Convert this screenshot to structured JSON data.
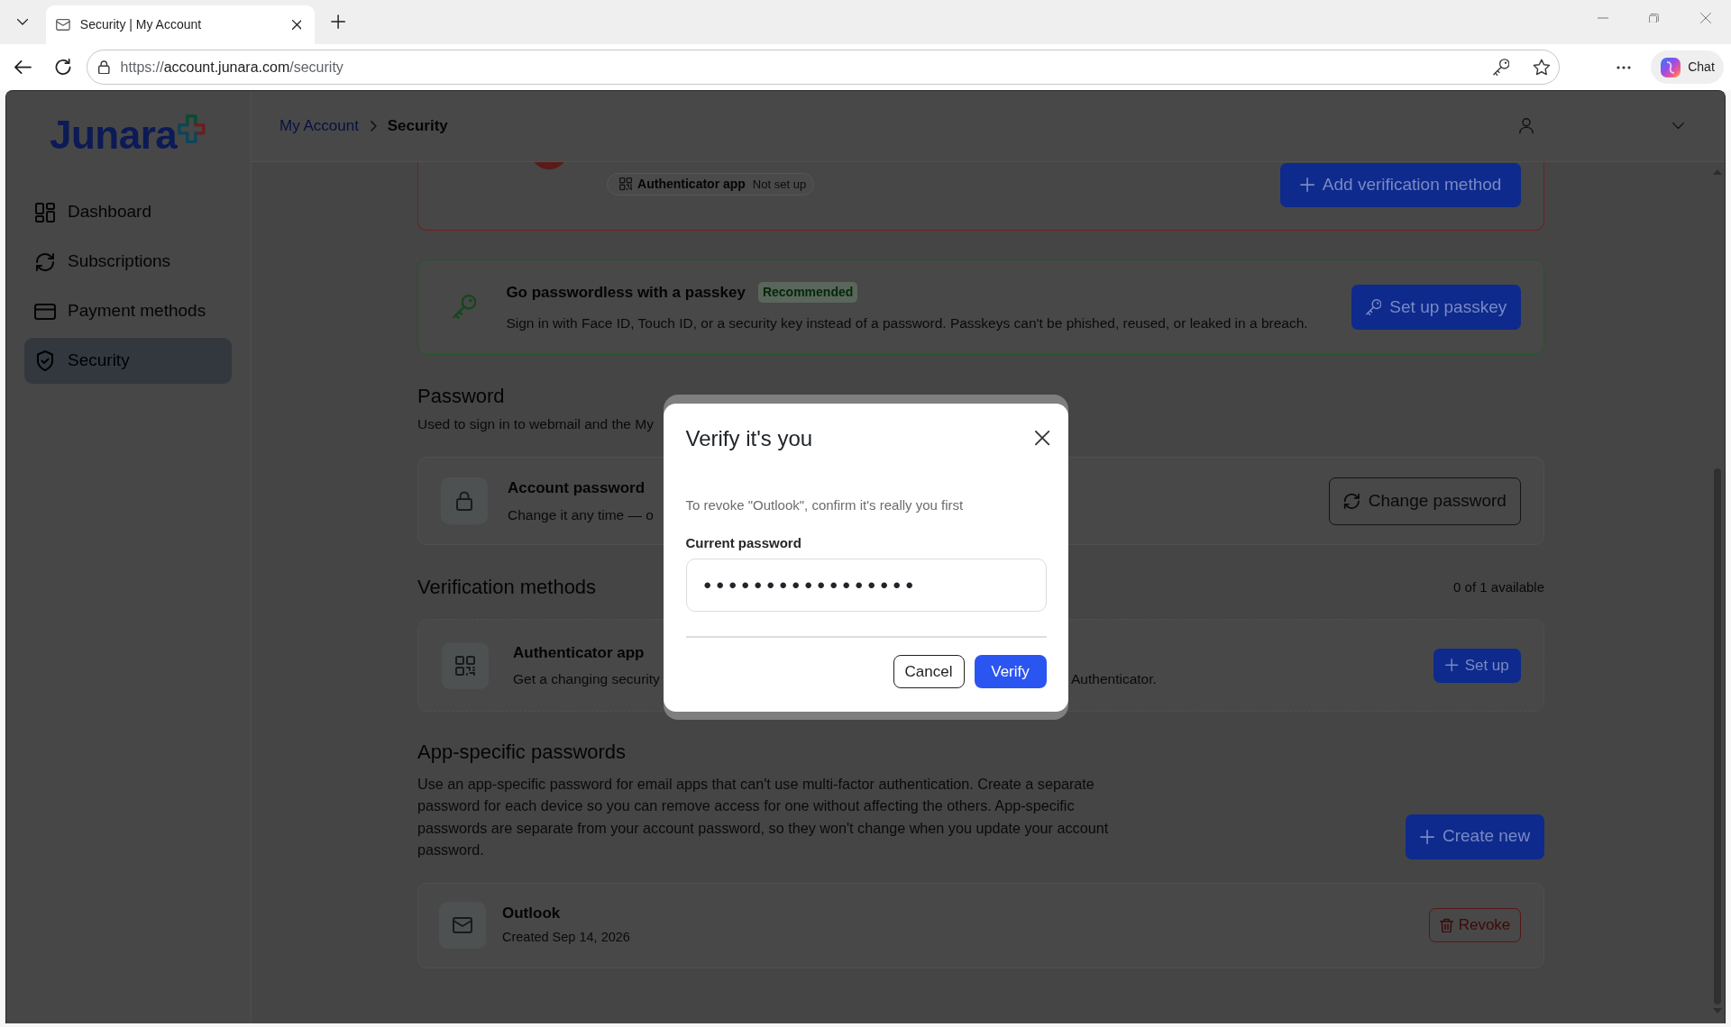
{
  "browser": {
    "tab": {
      "title": "Security | My Account"
    },
    "url": {
      "scheme": "https://",
      "host": "account.junara.com",
      "path": "/security"
    },
    "chat_button": "Chat"
  },
  "sidebar": {
    "logo": "Junara",
    "items": [
      {
        "label": "Dashboard",
        "selected": false
      },
      {
        "label": "Subscriptions",
        "selected": false
      },
      {
        "label": "Payment methods",
        "selected": false
      },
      {
        "label": "Security",
        "selected": true
      }
    ]
  },
  "header": {
    "breadcrumb": [
      {
        "label": "My Account",
        "kind": "link"
      },
      {
        "label": "Security",
        "kind": "current"
      }
    ]
  },
  "alert_card": {
    "chip": {
      "label": "Authenticator app",
      "status": "Not set up"
    },
    "button": "Add verification method"
  },
  "passkey_card": {
    "title": "Go passwordless with a passkey",
    "tag": "Recommended",
    "description": "Sign in with Face ID, Touch ID, or a security key instead of a password. Passkeys can't be phished, reused, or leaked in a breach.",
    "button": "Set up passkey"
  },
  "password_section": {
    "heading": "Password",
    "subtitle": "Used to sign in to webmail and the My",
    "card": {
      "title": "Account password",
      "description": "Change it any time — o",
      "button": "Change password"
    }
  },
  "verification_section": {
    "heading": "Verification methods",
    "count": "0 of 1 available",
    "methods": [
      {
        "title": "Authenticator app",
        "description": [
          "Get a changing security",
          "Authenticator."
        ],
        "button": "Set up"
      }
    ]
  },
  "app_passwords_section": {
    "heading": "App-specific passwords",
    "description": "Use an app-specific password for email apps that can't use multi-factor authentication. Create a separate password for each device so you can remove access for one without affecting the others. App-specific passwords are separate from your account password, so they won't change when you update your account password.",
    "button": "Create new",
    "items": [
      {
        "name": "Outlook",
        "created": "Created Sep 14, 2026",
        "button": "Revoke"
      }
    ]
  },
  "dialog": {
    "title": "Verify it's you",
    "message": "To revoke \"Outlook\", confirm it's really you first",
    "field": {
      "label": "Current password",
      "value": "•••••••••••••••••"
    },
    "buttons": [
      {
        "label": "Cancel",
        "kind": "secondary"
      },
      {
        "label": "Verify",
        "kind": "primary"
      }
    ]
  }
}
